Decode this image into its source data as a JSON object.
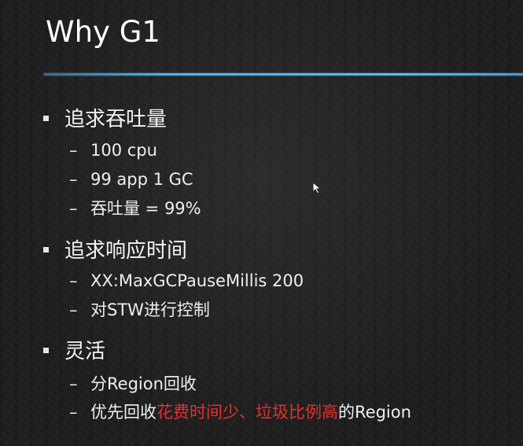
{
  "slide": {
    "title": "Why G1",
    "sections": [
      {
        "heading": "追求吞吐量",
        "items": [
          "100 cpu",
          "99 app 1 GC",
          "吞吐量 = 99%"
        ]
      },
      {
        "heading": "追求响应时间",
        "items": [
          "XX:MaxGCPauseMillis 200",
          "对STW进行控制"
        ]
      },
      {
        "heading": "灵活",
        "items": [
          "分Region回收"
        ],
        "mixed_item": {
          "before": "优先回收",
          "highlight": "花费时间少、垃圾比例高",
          "after": "的Region"
        }
      }
    ],
    "bullet_marker": "▪",
    "sub_marker": "–",
    "colors": {
      "accent_rule": "#4fb0e8",
      "highlight": "#e53030",
      "text": "#f2f2f2"
    },
    "cursor_icon": "mouse-pointer-icon"
  }
}
